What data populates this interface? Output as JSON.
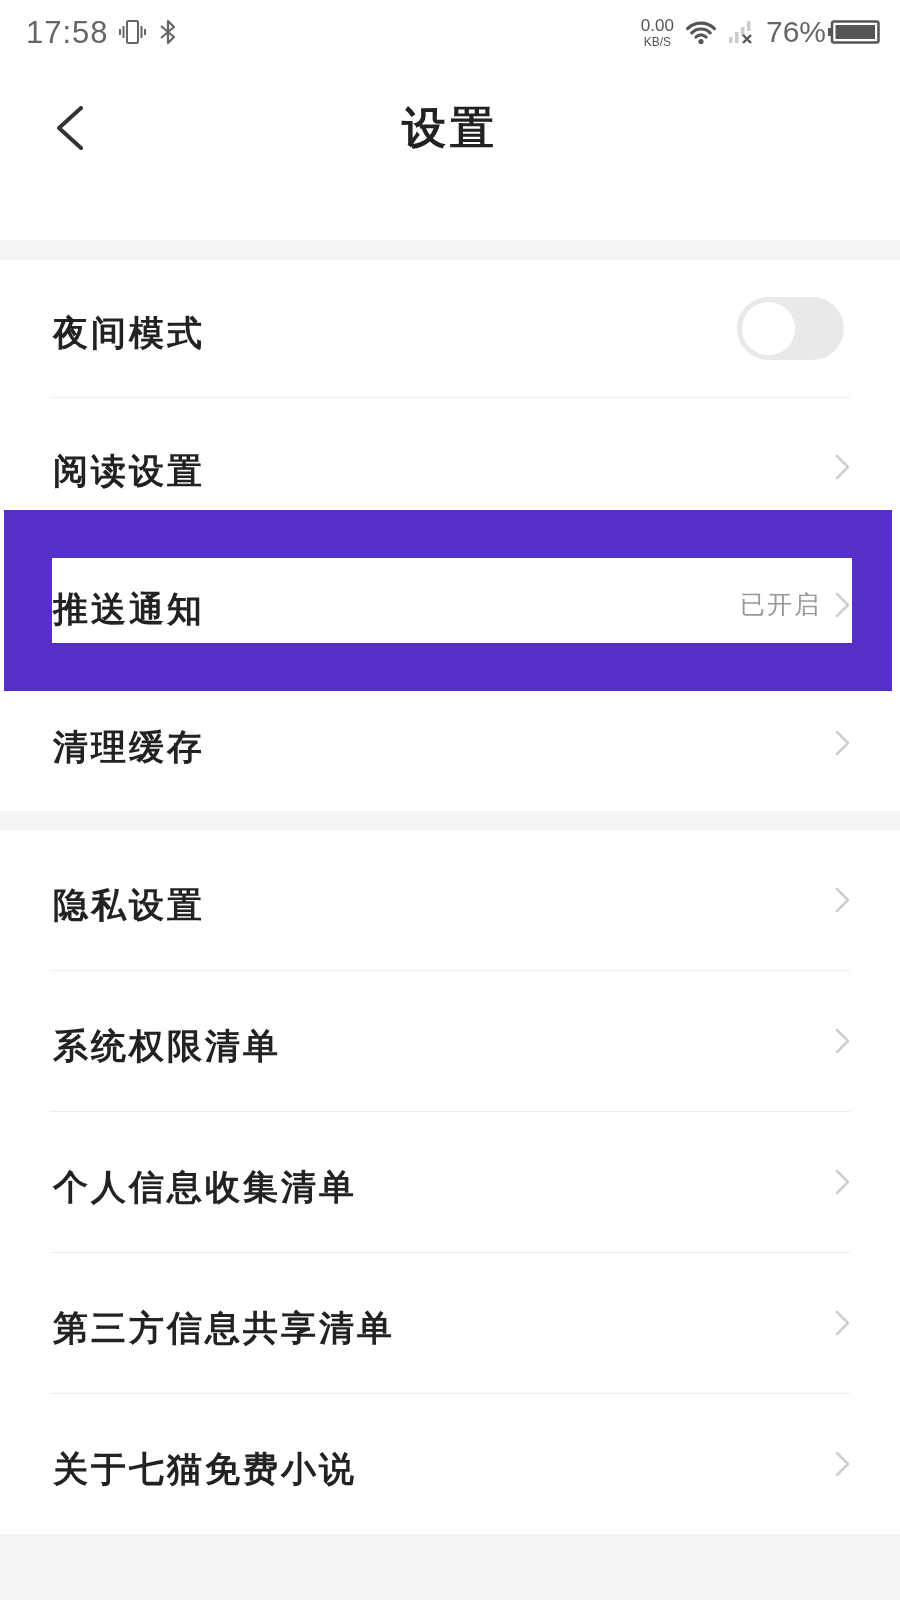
{
  "status_bar": {
    "time": "17:58",
    "net_speed": "0.00",
    "net_speed_unit": "KB/S",
    "battery": "76%"
  },
  "header": {
    "title": "设置"
  },
  "sections": [
    {
      "items": [
        {
          "kind": "toggle",
          "label": "夜间模式",
          "on": false,
          "highlighted": false
        },
        {
          "kind": "link",
          "label": "阅读设置",
          "highlighted": false
        },
        {
          "kind": "link",
          "label": "推送通知",
          "value": "已开启",
          "highlighted": true
        },
        {
          "kind": "link",
          "label": "清理缓存",
          "highlighted": false
        }
      ]
    },
    {
      "items": [
        {
          "kind": "link",
          "label": "隐私设置",
          "highlighted": false
        },
        {
          "kind": "link",
          "label": "系统权限清单",
          "highlighted": false
        },
        {
          "kind": "link",
          "label": "个人信息收集清单",
          "highlighted": false
        },
        {
          "kind": "link",
          "label": "第三方信息共享清单",
          "highlighted": false
        },
        {
          "kind": "link",
          "label": "关于七猫免费小说",
          "highlighted": false
        }
      ]
    }
  ]
}
